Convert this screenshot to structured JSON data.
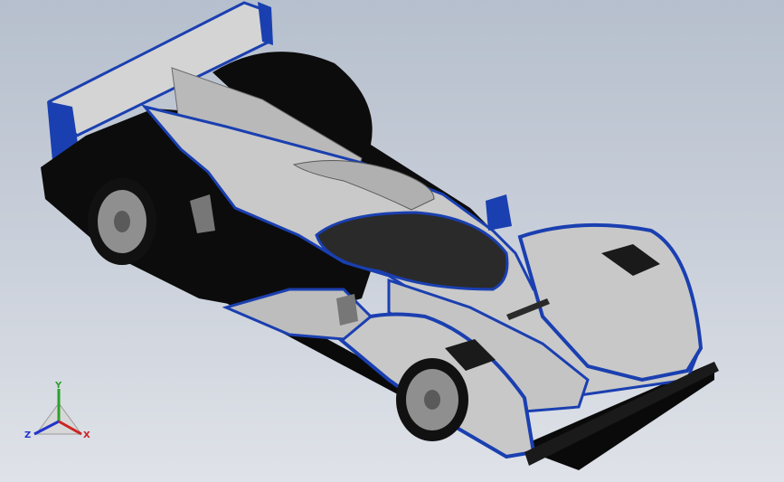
{
  "viewport": {
    "background_top": "#b6bfcd",
    "background_bottom": "#dfe2e8"
  },
  "model": {
    "body_color": "#c8c8c8",
    "trim_color": "#1a3fb0",
    "dark_color": "#0a0a0a",
    "wheel_color": "#9a9a9a"
  },
  "triad": {
    "y_label": "Y",
    "z_label": "Z",
    "x_label": "X",
    "y_color": "#2aa12a",
    "z_color": "#2233cc",
    "x_color": "#cc2222"
  }
}
